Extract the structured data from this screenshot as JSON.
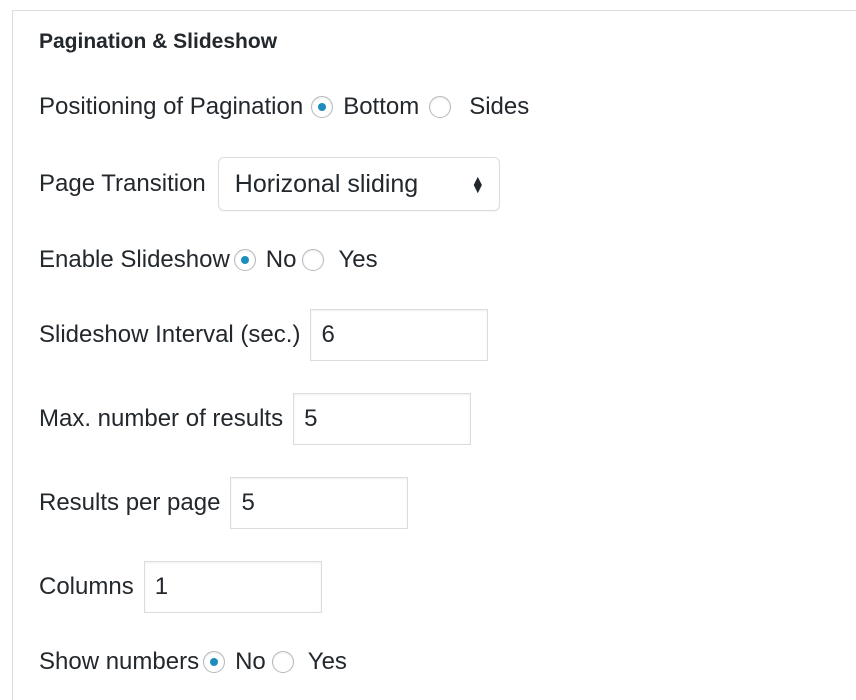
{
  "section": {
    "title": "Pagination & Slideshow"
  },
  "pagination_position": {
    "label": "Positioning of Pagination",
    "options": [
      {
        "label": "Bottom",
        "checked": true
      },
      {
        "label": "Sides",
        "checked": false
      }
    ]
  },
  "page_transition": {
    "label": "Page Transition",
    "selected": "Horizonal sliding"
  },
  "enable_slideshow": {
    "label": "Enable Slideshow",
    "options": [
      {
        "label": "No",
        "checked": true
      },
      {
        "label": "Yes",
        "checked": false
      }
    ]
  },
  "slideshow_interval": {
    "label": "Slideshow Interval (sec.)",
    "value": "6"
  },
  "max_results": {
    "label": "Max. number of results",
    "value": "5"
  },
  "results_per_page": {
    "label": "Results per page",
    "value": "5"
  },
  "columns": {
    "label": "Columns",
    "value": "1"
  },
  "show_numbers": {
    "label": "Show numbers",
    "options": [
      {
        "label": "No",
        "checked": true
      },
      {
        "label": "Yes",
        "checked": false
      }
    ]
  }
}
